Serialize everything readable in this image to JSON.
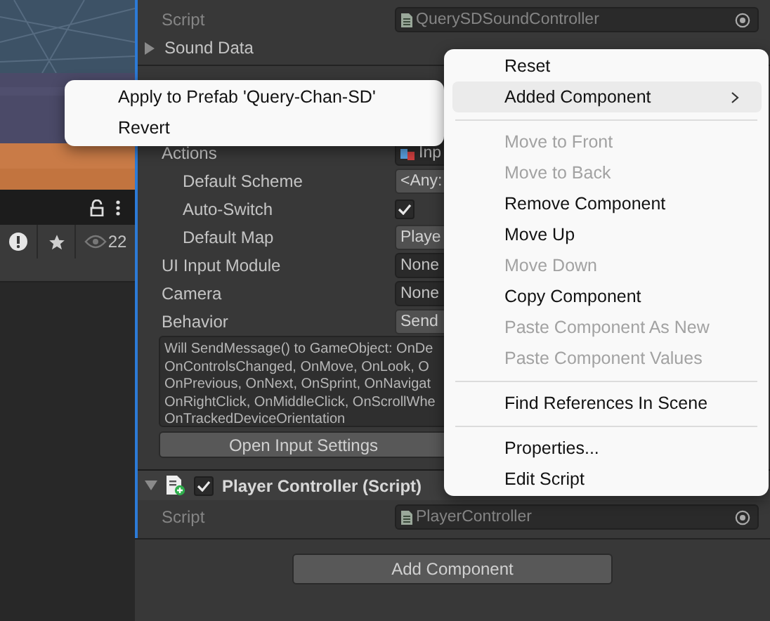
{
  "hierarchy": {
    "visible_count": "22"
  },
  "inspector": {
    "script": {
      "label": "Script",
      "value": "QuerySDSoundController",
      "disabled": true
    },
    "sound_data": {
      "label": "Sound Data",
      "expanded": false
    },
    "properties": [
      {
        "kind": "object",
        "label": "Actions",
        "value": "Inp",
        "children": [
          {
            "kind": "dropdown",
            "label": "Default Scheme",
            "value": "<Any:"
          },
          {
            "kind": "checkbox",
            "label": "Auto-Switch",
            "checked": true
          },
          {
            "kind": "dropdown",
            "label": "Default Map",
            "value": "Playe"
          }
        ]
      },
      {
        "kind": "object",
        "label": "UI Input Module",
        "value": "None"
      },
      {
        "kind": "object",
        "label": "Camera",
        "value": "None"
      },
      {
        "kind": "dropdown",
        "label": "Behavior",
        "value": "Send"
      }
    ],
    "help_text": "Will SendMessage() to GameObject: OnDe\nOnControlsChanged, OnMove, OnLook, O\nOnPrevious, OnNext, OnSprint, OnNavigat\nOnRightClick, OnMiddleClick, OnScrollWhe\nOnTrackedDeviceOrientation",
    "settings_button": "Open Input Settings",
    "component": {
      "title": "Player Controller (Script)",
      "expanded": true,
      "enabled": true,
      "script": {
        "label": "Script",
        "value": "PlayerController",
        "disabled": true
      }
    },
    "add_button": "Add Component"
  },
  "submenu": {
    "items": [
      {
        "kind": "item",
        "label": "Apply to Prefab 'Query-Chan-SD'",
        "disabled": false,
        "selected": false
      },
      {
        "kind": "item",
        "label": "Revert",
        "disabled": false,
        "selected": false
      }
    ]
  },
  "context_menu": {
    "items": [
      {
        "kind": "item",
        "label": "Reset",
        "disabled": false,
        "selected": false
      },
      {
        "kind": "submenu",
        "label": "Added Component",
        "disabled": false,
        "selected": true
      },
      {
        "kind": "separator"
      },
      {
        "kind": "item",
        "label": "Move to Front",
        "disabled": true,
        "selected": false
      },
      {
        "kind": "item",
        "label": "Move to Back",
        "disabled": true,
        "selected": false
      },
      {
        "kind": "item",
        "label": "Remove Component",
        "disabled": false,
        "selected": false
      },
      {
        "kind": "item",
        "label": "Move Up",
        "disabled": false,
        "selected": false
      },
      {
        "kind": "item",
        "label": "Move Down",
        "disabled": true,
        "selected": false
      },
      {
        "kind": "item",
        "label": "Copy Component",
        "disabled": false,
        "selected": false
      },
      {
        "kind": "item",
        "label": "Paste Component As New",
        "disabled": true,
        "selected": false
      },
      {
        "kind": "item",
        "label": "Paste Component Values",
        "disabled": true,
        "selected": false
      },
      {
        "kind": "separator"
      },
      {
        "kind": "item",
        "label": "Find References In Scene",
        "disabled": false,
        "selected": false
      },
      {
        "kind": "separator"
      },
      {
        "kind": "item",
        "label": "Properties...",
        "disabled": false,
        "selected": false
      },
      {
        "kind": "item",
        "label": "Edit Script",
        "disabled": false,
        "selected": false
      }
    ]
  }
}
